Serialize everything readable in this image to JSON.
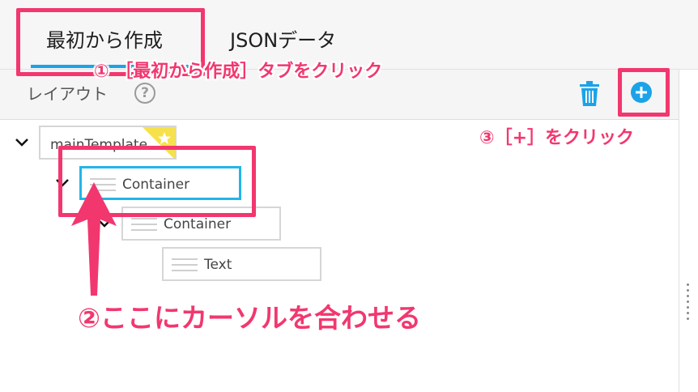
{
  "tabs": [
    {
      "label": "最初から作成",
      "active": true
    },
    {
      "label": "JSONデータ",
      "active": false
    }
  ],
  "layout": {
    "title": "レイアウト",
    "help_symbol": "?",
    "icons": {
      "delete": "trash-icon",
      "add": "plus-circle-icon"
    }
  },
  "tree": {
    "root": {
      "label": "mainTemplate",
      "badge_icon": "star-icon"
    },
    "children": [
      {
        "label": "Container",
        "selected": true
      },
      {
        "label": "Container",
        "selected": false
      },
      {
        "label": "Text",
        "selected": false
      }
    ]
  },
  "annotations": {
    "step1": "① ［最初から作成］タブをクリック",
    "step2": "②ここにカーソルを合わせる",
    "step3": "③［+］をクリック"
  },
  "colors": {
    "accent": "#1aa3e8",
    "annotation": "#f2376f",
    "selected_border": "#22b5e8",
    "star_flag": "#f7e14a"
  }
}
